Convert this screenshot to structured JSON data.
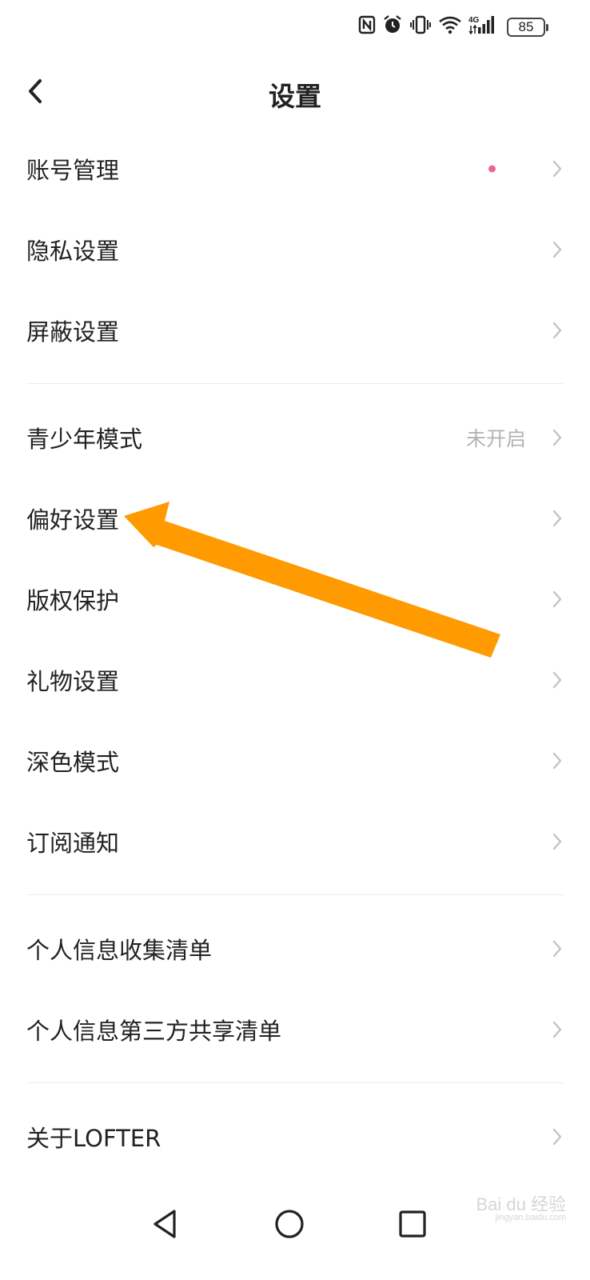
{
  "status_bar": {
    "battery": "85",
    "network": "4G",
    "icons": [
      "nfc-icon",
      "alarm-icon",
      "vibrate-icon",
      "wifi-icon",
      "signal-icon",
      "battery-icon"
    ]
  },
  "header": {
    "title": "设置",
    "back_icon": "chevron-left-icon"
  },
  "settings": {
    "groups": [
      [
        {
          "label": "账号管理",
          "badge": "red-dot"
        },
        {
          "label": "隐私设置"
        },
        {
          "label": "屏蔽设置"
        }
      ],
      [
        {
          "label": "青少年模式",
          "value": "未开启"
        },
        {
          "label": "偏好设置"
        },
        {
          "label": "版权保护"
        },
        {
          "label": "礼物设置"
        },
        {
          "label": "深色模式"
        },
        {
          "label": "订阅通知"
        }
      ],
      [
        {
          "label": "个人信息收集清单"
        },
        {
          "label": "个人信息第三方共享清单"
        }
      ],
      [
        {
          "label": "关于LOFTER"
        }
      ]
    ]
  },
  "annotation": {
    "color": "#ff9a00",
    "icon": "arrow-icon"
  },
  "nav_bar": {
    "icons": [
      "back-triangle-icon",
      "home-circle-icon",
      "recents-square-icon"
    ]
  },
  "watermark": {
    "text": "Bai du 经验",
    "sub": "jingyan.baidu.com"
  },
  "colors": {
    "badge": "#e9688b",
    "chevron": "#c4c4c4",
    "divider": "#ececec",
    "value": "#b4b4b4"
  }
}
